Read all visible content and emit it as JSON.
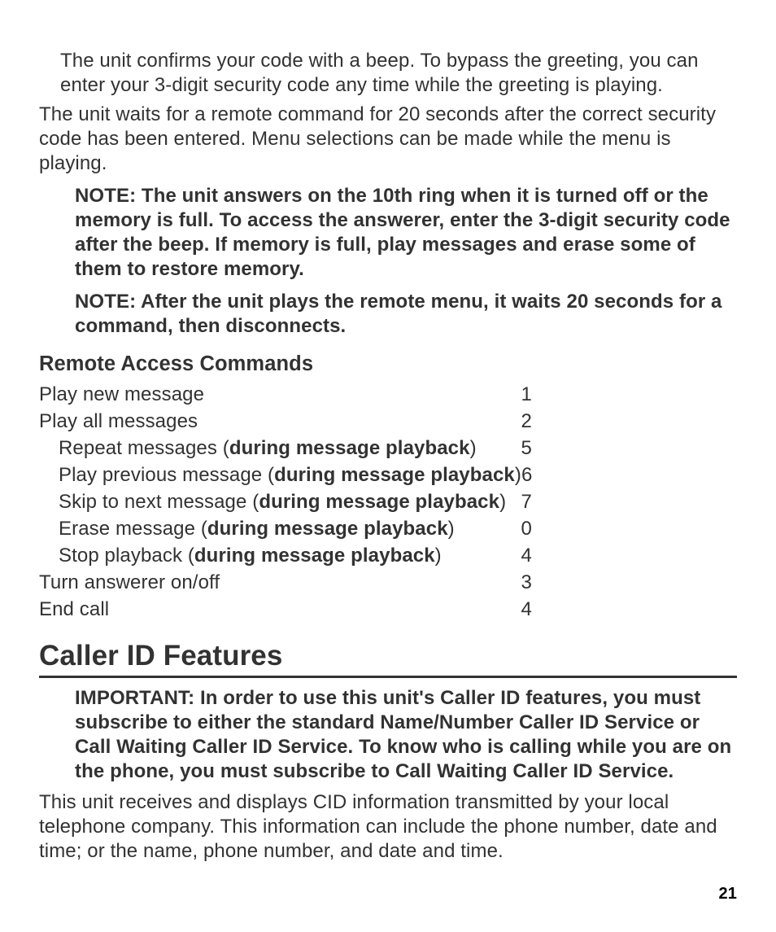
{
  "intro": {
    "p1": "The unit confirms your code with a beep. To bypass the greeting, you can enter your 3-digit security code any time while the greeting is playing.",
    "p2": "The unit waits for a remote command for 20 seconds after the correct security code has been entered. Menu selections can be made while the menu is playing.",
    "note1": "NOTE: The unit answers on the 10th ring when it is turned off or the memory is full. To access the answerer, enter the 3-digit security code after the beep. If memory is full, play messages and erase some of them to restore memory.",
    "note2": "NOTE: After the unit plays the remote menu, it waits 20 seconds for a command, then disconnects."
  },
  "remote": {
    "heading": "Remote Access Commands",
    "qualifier": "during message playback",
    "items": [
      {
        "label": "Play new message",
        "num": "1",
        "indent": 0,
        "qualified": false
      },
      {
        "label": "Play all messages",
        "num": "2",
        "indent": 0,
        "qualified": false
      },
      {
        "label": "Repeat messages",
        "num": "5",
        "indent": 1,
        "qualified": true
      },
      {
        "label": "Play previous message",
        "num": "6",
        "indent": 1,
        "qualified": true
      },
      {
        "label": "Skip to next message",
        "num": "7",
        "indent": 1,
        "qualified": true
      },
      {
        "label": "Erase message",
        "num": "0",
        "indent": 1,
        "qualified": true
      },
      {
        "label": "Stop playback",
        "num": "4",
        "indent": 1,
        "qualified": true
      },
      {
        "label": "Turn answerer on/off",
        "num": "3",
        "indent": 0,
        "qualified": false
      },
      {
        "label": "End call",
        "num": "4",
        "indent": 0,
        "qualified": false
      }
    ]
  },
  "cid": {
    "heading": "Caller ID Features",
    "important": "IMPORTANT: In order to use this unit's Caller ID features, you must subscribe to either the standard Name/Number Caller ID Service or Call Waiting Caller ID Service. To know who is calling while you are on the phone, you must subscribe to Call Waiting Caller ID Service.",
    "body": "This unit receives and displays CID information transmitted by your local telephone company. This information can include the phone number, date and time; or the name, phone number, and date and time."
  },
  "page_number": "21"
}
